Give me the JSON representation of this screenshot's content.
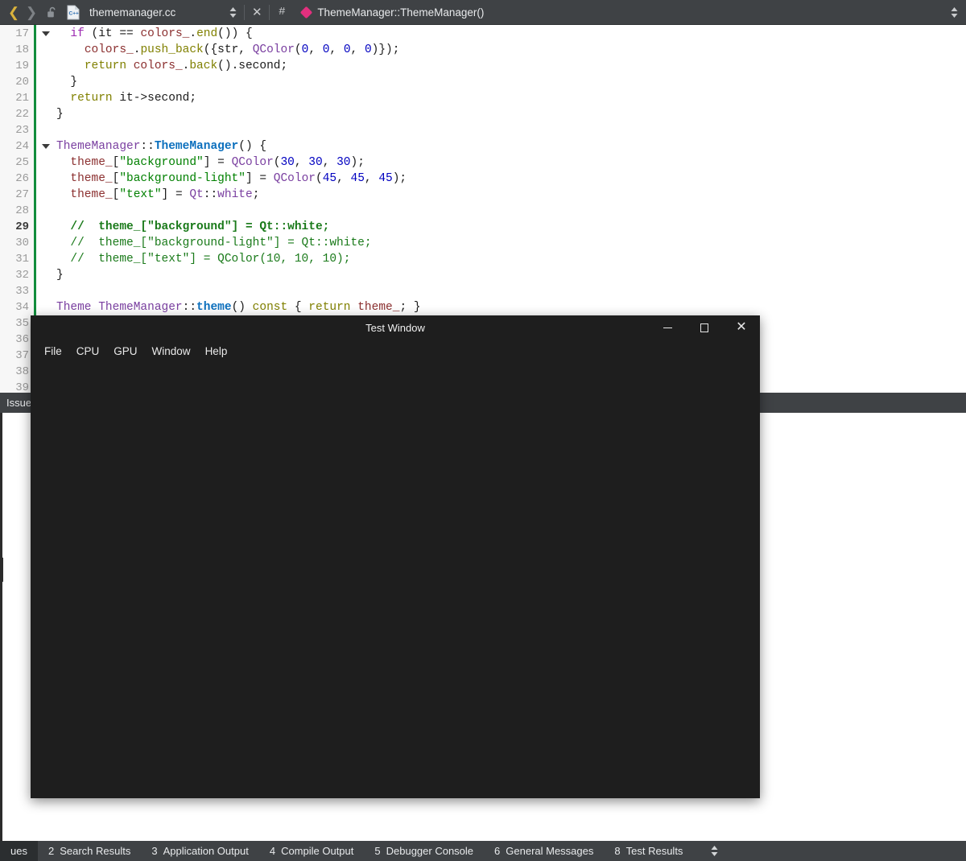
{
  "toolbar": {
    "back_icon": "chevron-left-icon",
    "forward_icon": "chevron-right-icon",
    "lock_icon": "unlocked-padlock-icon",
    "file_icon": "cpp-file-icon",
    "file_name": "thememanager.cc",
    "file_selector_icon": "updown-spinner-icon",
    "close_icon": "close-x-icon",
    "hash_label": "#",
    "symbol_icon": "pink-diamond-icon",
    "symbol_name": "ThemeManager::ThemeManager()",
    "split_icon": "updown-spinner-icon"
  },
  "editor": {
    "current_line": 29,
    "fold_lines": [
      17,
      24
    ],
    "lines": [
      {
        "num": 17,
        "tokens": [
          {
            "t": "  ",
            "c": "t-plain"
          },
          {
            "t": "if",
            "c": "t-kw"
          },
          {
            "t": " (",
            "c": "t-plain"
          },
          {
            "t": "it",
            "c": "t-plain"
          },
          {
            "t": " == ",
            "c": "t-plain"
          },
          {
            "t": "colors_",
            "c": "t-var"
          },
          {
            "t": ".",
            "c": "t-plain"
          },
          {
            "t": "end",
            "c": "t-kw2"
          },
          {
            "t": "()) {",
            "c": "t-plain"
          }
        ]
      },
      {
        "num": 18,
        "tokens": [
          {
            "t": "    ",
            "c": "t-plain"
          },
          {
            "t": "colors_",
            "c": "t-var"
          },
          {
            "t": ".",
            "c": "t-plain"
          },
          {
            "t": "push_back",
            "c": "t-kw2"
          },
          {
            "t": "({",
            "c": "t-plain"
          },
          {
            "t": "str",
            "c": "t-plain"
          },
          {
            "t": ", ",
            "c": "t-plain"
          },
          {
            "t": "QColor",
            "c": "t-cls"
          },
          {
            "t": "(",
            "c": "t-plain"
          },
          {
            "t": "0",
            "c": "t-num"
          },
          {
            "t": ", ",
            "c": "t-plain"
          },
          {
            "t": "0",
            "c": "t-num"
          },
          {
            "t": ", ",
            "c": "t-plain"
          },
          {
            "t": "0",
            "c": "t-num"
          },
          {
            "t": ", ",
            "c": "t-plain"
          },
          {
            "t": "0",
            "c": "t-num"
          },
          {
            "t": ")});",
            "c": "t-plain"
          }
        ]
      },
      {
        "num": 19,
        "tokens": [
          {
            "t": "    ",
            "c": "t-plain"
          },
          {
            "t": "return",
            "c": "t-kw2"
          },
          {
            "t": " ",
            "c": "t-plain"
          },
          {
            "t": "colors_",
            "c": "t-var"
          },
          {
            "t": ".",
            "c": "t-plain"
          },
          {
            "t": "back",
            "c": "t-kw2"
          },
          {
            "t": "().",
            "c": "t-plain"
          },
          {
            "t": "second",
            "c": "t-plain"
          },
          {
            "t": ";",
            "c": "t-plain"
          }
        ]
      },
      {
        "num": 20,
        "tokens": [
          {
            "t": "  }",
            "c": "t-plain"
          }
        ]
      },
      {
        "num": 21,
        "tokens": [
          {
            "t": "  ",
            "c": "t-plain"
          },
          {
            "t": "return",
            "c": "t-kw2"
          },
          {
            "t": " ",
            "c": "t-plain"
          },
          {
            "t": "it",
            "c": "t-plain"
          },
          {
            "t": "->",
            "c": "t-plain"
          },
          {
            "t": "second",
            "c": "t-plain"
          },
          {
            "t": ";",
            "c": "t-plain"
          }
        ]
      },
      {
        "num": 22,
        "tokens": [
          {
            "t": "}",
            "c": "t-plain"
          }
        ]
      },
      {
        "num": 23,
        "tokens": []
      },
      {
        "num": 24,
        "tokens": [
          {
            "t": "ThemeManager",
            "c": "t-cls"
          },
          {
            "t": "::",
            "c": "t-plain"
          },
          {
            "t": "ThemeManager",
            "c": "t-fn"
          },
          {
            "t": "() {",
            "c": "t-plain"
          }
        ]
      },
      {
        "num": 25,
        "tokens": [
          {
            "t": "  ",
            "c": "t-plain"
          },
          {
            "t": "theme_",
            "c": "t-var"
          },
          {
            "t": "[",
            "c": "t-plain"
          },
          {
            "t": "\"background\"",
            "c": "t-str"
          },
          {
            "t": "] = ",
            "c": "t-plain"
          },
          {
            "t": "QColor",
            "c": "t-cls"
          },
          {
            "t": "(",
            "c": "t-plain"
          },
          {
            "t": "30",
            "c": "t-num"
          },
          {
            "t": ", ",
            "c": "t-plain"
          },
          {
            "t": "30",
            "c": "t-num"
          },
          {
            "t": ", ",
            "c": "t-plain"
          },
          {
            "t": "30",
            "c": "t-num"
          },
          {
            "t": ");",
            "c": "t-plain"
          }
        ]
      },
      {
        "num": 26,
        "tokens": [
          {
            "t": "  ",
            "c": "t-plain"
          },
          {
            "t": "theme_",
            "c": "t-var"
          },
          {
            "t": "[",
            "c": "t-plain"
          },
          {
            "t": "\"background-light\"",
            "c": "t-str"
          },
          {
            "t": "] = ",
            "c": "t-plain"
          },
          {
            "t": "QColor",
            "c": "t-cls"
          },
          {
            "t": "(",
            "c": "t-plain"
          },
          {
            "t": "45",
            "c": "t-num"
          },
          {
            "t": ", ",
            "c": "t-plain"
          },
          {
            "t": "45",
            "c": "t-num"
          },
          {
            "t": ", ",
            "c": "t-plain"
          },
          {
            "t": "45",
            "c": "t-num"
          },
          {
            "t": ");",
            "c": "t-plain"
          }
        ]
      },
      {
        "num": 27,
        "tokens": [
          {
            "t": "  ",
            "c": "t-plain"
          },
          {
            "t": "theme_",
            "c": "t-var"
          },
          {
            "t": "[",
            "c": "t-plain"
          },
          {
            "t": "\"text\"",
            "c": "t-str"
          },
          {
            "t": "] = ",
            "c": "t-plain"
          },
          {
            "t": "Qt",
            "c": "t-cls"
          },
          {
            "t": "::",
            "c": "t-plain"
          },
          {
            "t": "white",
            "c": "t-cls"
          },
          {
            "t": ";",
            "c": "t-plain"
          }
        ]
      },
      {
        "num": 28,
        "tokens": []
      },
      {
        "num": 29,
        "tokens": [
          {
            "t": "  //  theme_[\"background\"] = Qt::white;",
            "c": "t-cmt"
          }
        ]
      },
      {
        "num": 30,
        "tokens": [
          {
            "t": "  //  theme_[\"background-light\"] = Qt::white;",
            "c": "t-cmt"
          }
        ]
      },
      {
        "num": 31,
        "tokens": [
          {
            "t": "  //  theme_[\"text\"] = QColor(10, 10, 10);",
            "c": "t-cmt"
          }
        ]
      },
      {
        "num": 32,
        "tokens": [
          {
            "t": "}",
            "c": "t-plain"
          }
        ]
      },
      {
        "num": 33,
        "tokens": []
      },
      {
        "num": 34,
        "tokens": [
          {
            "t": "Theme",
            "c": "t-cls"
          },
          {
            "t": " ",
            "c": "t-plain"
          },
          {
            "t": "ThemeManager",
            "c": "t-cls"
          },
          {
            "t": "::",
            "c": "t-plain"
          },
          {
            "t": "theme",
            "c": "t-fn"
          },
          {
            "t": "() ",
            "c": "t-plain"
          },
          {
            "t": "const",
            "c": "t-kw2"
          },
          {
            "t": " { ",
            "c": "t-plain"
          },
          {
            "t": "return",
            "c": "t-kw2"
          },
          {
            "t": " ",
            "c": "t-plain"
          },
          {
            "t": "theme_",
            "c": "t-var"
          },
          {
            "t": "; }",
            "c": "t-plain"
          }
        ]
      },
      {
        "num": 35,
        "tokens": []
      },
      {
        "num": 36,
        "tokens": []
      },
      {
        "num": 37,
        "tokens": []
      },
      {
        "num": 38,
        "tokens": []
      },
      {
        "num": 39,
        "tokens": []
      }
    ]
  },
  "issues_bar": {
    "label": "Issue"
  },
  "test_window": {
    "title": "Test Window",
    "minimize_icon": "minimize-icon",
    "maximize_icon": "maximize-icon",
    "close_icon": "close-icon",
    "menu": [
      {
        "label": "File"
      },
      {
        "label": "CPU"
      },
      {
        "label": "GPU"
      },
      {
        "label": "Window"
      },
      {
        "label": "Help"
      }
    ]
  },
  "bottom_bar": {
    "tabs": [
      {
        "num": "",
        "label": "ues",
        "active": true
      },
      {
        "num": "2",
        "label": "Search Results",
        "active": false
      },
      {
        "num": "3",
        "label": "Application Output",
        "active": false
      },
      {
        "num": "4",
        "label": "Compile Output",
        "active": false
      },
      {
        "num": "5",
        "label": "Debugger Console",
        "active": false
      },
      {
        "num": "6",
        "label": "General Messages",
        "active": false
      },
      {
        "num": "8",
        "label": "Test Results",
        "active": false
      }
    ],
    "spinner_icon": "updown-spinner-icon"
  },
  "colors": {
    "toolbar_bg": "#3f4245",
    "editor_bg": "#ffffff",
    "gutter_bg": "#f7f7f7",
    "change_bar": "#128d3c",
    "test_window_bg": "#1e1e1e",
    "symbol_diamond": "#e2307e",
    "back_arrow": "#d9b23c"
  }
}
